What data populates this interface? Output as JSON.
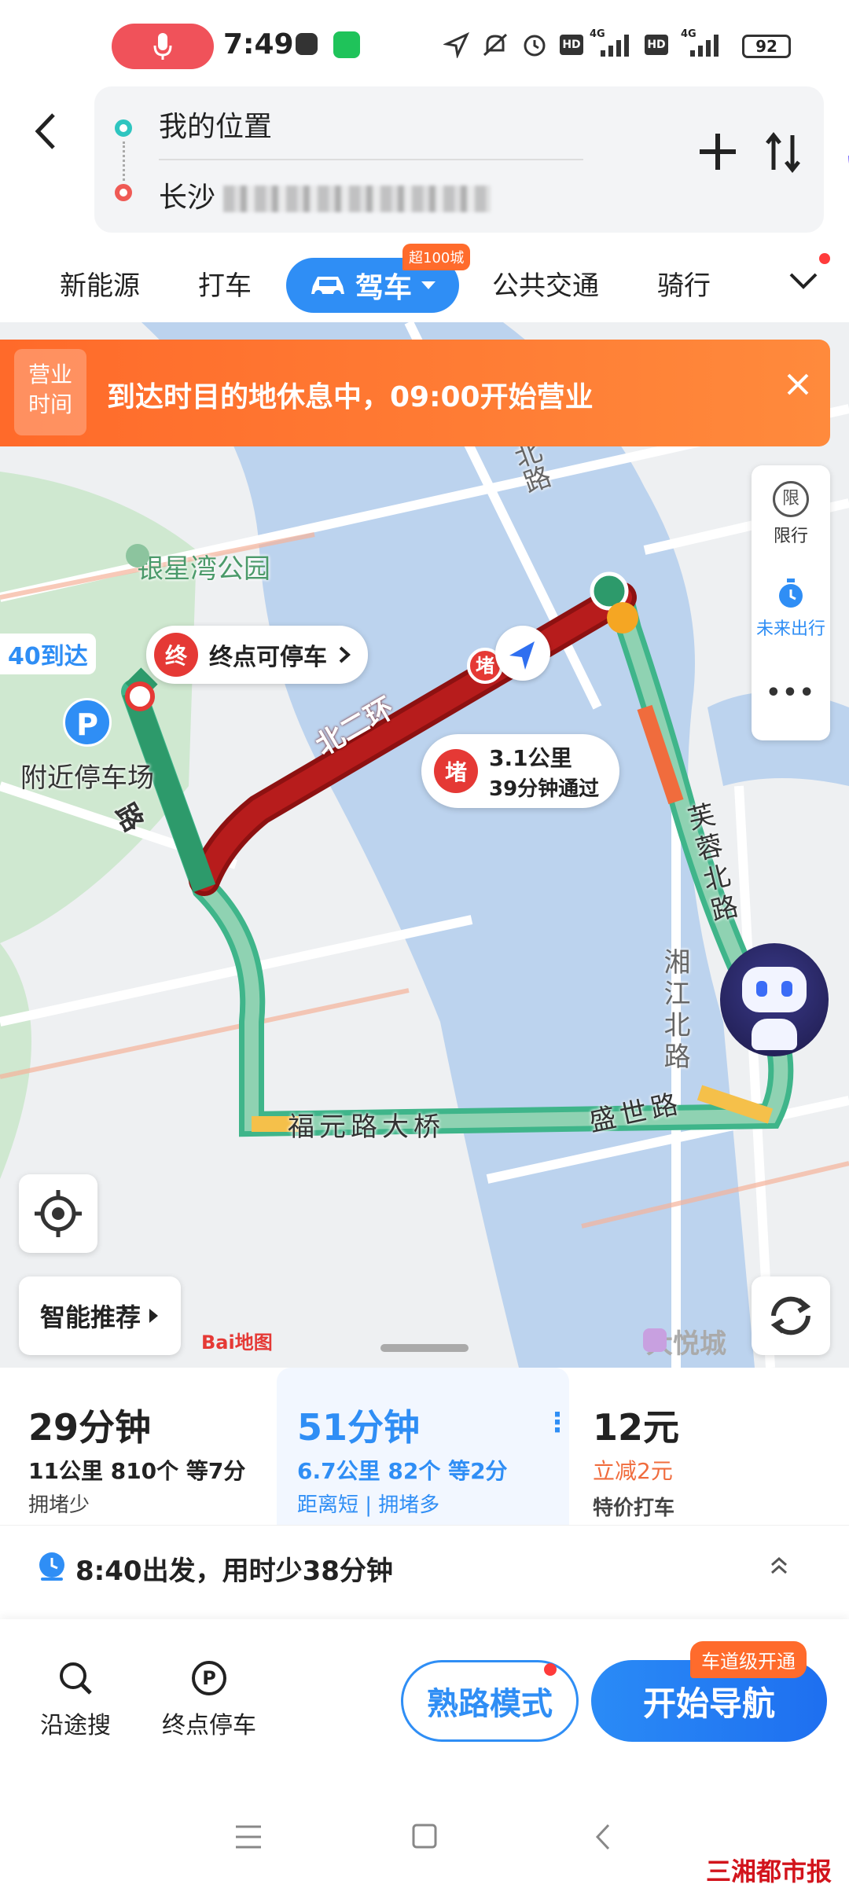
{
  "status_bar": {
    "time": "7:49",
    "hd1": "HD",
    "net1": "4G",
    "hd2": "HD",
    "net2": "4G",
    "battery": "92"
  },
  "header": {
    "from": "我的位置",
    "to_prefix": "长沙"
  },
  "tabs": {
    "items": [
      "新能源",
      "打车",
      "公共交通",
      "骑行"
    ],
    "active": "驾车",
    "active_badge": "超100城"
  },
  "banner": {
    "tag_line1": "营业",
    "tag_line2": "时间",
    "text": "到达时目的地休息中，09:00开始营业"
  },
  "side_panel": {
    "limit_icon": "限",
    "limit_label": "限行",
    "future_label": "未来出行",
    "more": "•••"
  },
  "map": {
    "park_label": "银星湾公园",
    "arrive_label": "40到达",
    "end_parking_badge": "终",
    "end_parking_text": "终点可停车",
    "parking_label": "附近停车场",
    "parking_icon": "P",
    "jam_badge": "堵",
    "jam_distance": "3.1公里",
    "jam_time": "39分钟通过",
    "road_ring": "北二环",
    "road_a": "路",
    "road_furong": "芙蓉北路",
    "road_xiangjiang": "湘江北路",
    "road_fuyuan": "福元路大桥",
    "road_shengshi": "盛世路",
    "road_north": "北路",
    "mall": "大悦城",
    "smart": "智能推荐",
    "logo": "Bai地图"
  },
  "routes": [
    {
      "time": "29分钟",
      "distance": "11公里",
      "lights": "10个",
      "wait": "等7分",
      "tag": "拥堵少",
      "selected": false
    },
    {
      "time": "51分钟",
      "distance": "6.7公里",
      "lights": "2个",
      "wait": "等2分",
      "tag": "距离短 | 拥堵多",
      "selected": true
    },
    {
      "time": "12元",
      "discount": "立减2元",
      "tag": "特价打车"
    }
  ],
  "depart": {
    "text": "8:40出发，用时少38分钟"
  },
  "actions": {
    "search": "沿途搜",
    "parking": "终点停车",
    "familiar": "熟路模式",
    "navigate": "开始导航",
    "lane_badge": "车道级开通"
  },
  "watermark": "三湘都市报",
  "colors": {
    "accent": "#2f8ef5",
    "jam": "#b71c1c",
    "banner": "#ff7a33",
    "smooth": "#3fb58a"
  }
}
